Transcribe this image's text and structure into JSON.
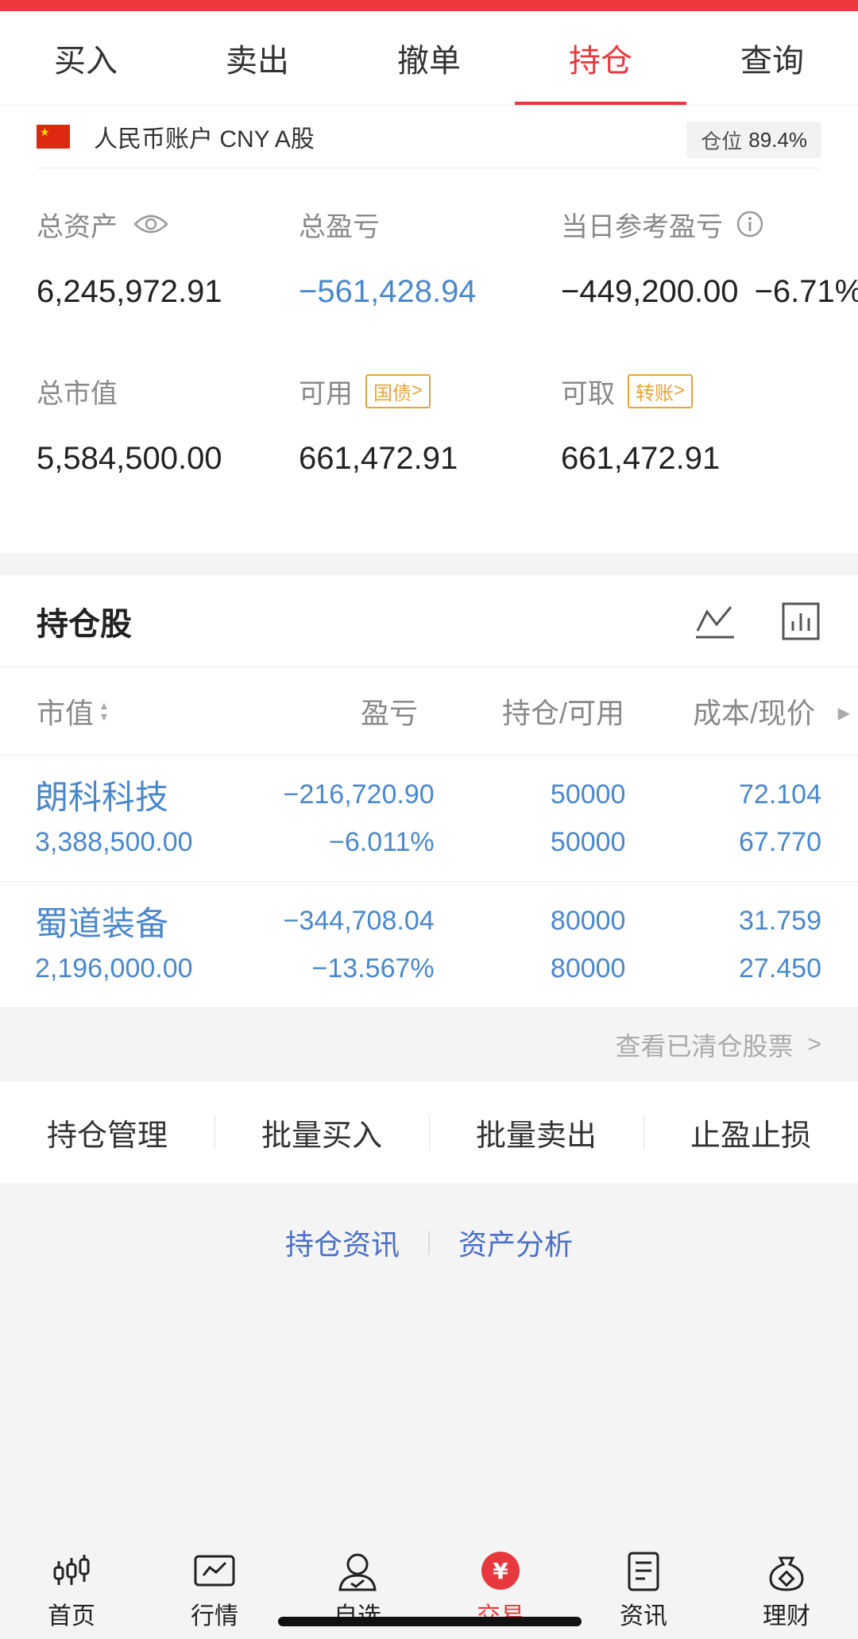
{
  "tabs": [
    {
      "label": "买入"
    },
    {
      "label": "卖出"
    },
    {
      "label": "撤单"
    },
    {
      "label": "持仓",
      "active": true
    },
    {
      "label": "查询"
    }
  ],
  "account": {
    "label": "人民币账户 CNY A股",
    "position_label": "仓位",
    "position_value": "89.4%"
  },
  "summary": {
    "total_assets_label": "总资产",
    "total_assets": "6,245,972.91",
    "total_pl_label": "总盈亏",
    "total_pl": "−561,428.94",
    "day_pl_label": "当日参考盈亏",
    "day_pl": "−449,200.00",
    "day_pl_pct": "−6.71%",
    "market_value_label": "总市值",
    "market_value": "5,584,500.00",
    "available_label": "可用",
    "available_tag": "国债",
    "available": "661,472.91",
    "withdrawable_label": "可取",
    "withdrawable_tag": "转账",
    "withdrawable": "661,472.91"
  },
  "holdings": {
    "title": "持仓股",
    "columns": [
      "市值",
      "盈亏",
      "持仓/可用",
      "成本/现价"
    ],
    "rows": [
      {
        "name": "朗科科技",
        "market_value": "3,388,500.00",
        "pl": "−216,720.90",
        "pl_pct": "−6.011%",
        "hold": "50000",
        "available": "50000",
        "cost": "72.104",
        "price": "67.770"
      },
      {
        "name": "蜀道装备",
        "market_value": "2,196,000.00",
        "pl": "−344,708.04",
        "pl_pct": "−13.567%",
        "hold": "80000",
        "available": "80000",
        "cost": "31.759",
        "price": "27.450"
      }
    ],
    "cleared_link": "查看已清仓股票"
  },
  "actions": [
    "持仓管理",
    "批量买入",
    "批量卖出",
    "止盈止损"
  ],
  "links": [
    "持仓资讯",
    "资产分析"
  ],
  "bottom_nav": [
    {
      "label": "首页",
      "icon": "home-candles-icon"
    },
    {
      "label": "行情",
      "icon": "market-chart-icon"
    },
    {
      "label": "自选",
      "icon": "watchlist-person-icon"
    },
    {
      "label": "交易",
      "icon": "trade-yen-icon",
      "active": true
    },
    {
      "label": "资讯",
      "icon": "news-document-icon"
    },
    {
      "label": "理财",
      "icon": "wealth-bag-icon"
    }
  ],
  "colors": {
    "accent": "#e8383d",
    "quote_blue": "#4a88cc",
    "link_blue": "#4a6fc8",
    "tag_orange": "#e6a43a"
  }
}
